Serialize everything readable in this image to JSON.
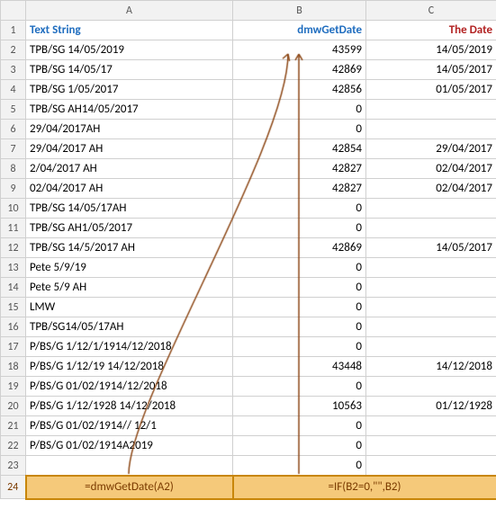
{
  "columns": {
    "row_num": "",
    "a": "A",
    "b": "B",
    "c": "C"
  },
  "header_row": {
    "label_a": "Text String",
    "label_b": "dmwGetDate",
    "label_c": "The Date"
  },
  "rows": [
    {
      "num": 2,
      "a": "TPB/SG 14/05/2019",
      "b": "43599",
      "c": "14/05/2019"
    },
    {
      "num": 3,
      "a": "TPB/SG 14/05/17",
      "b": "42869",
      "c": "14/05/2017"
    },
    {
      "num": 4,
      "a": "TPB/SG 1/05/2017",
      "b": "42856",
      "c": "01/05/2017"
    },
    {
      "num": 5,
      "a": "TPB/SG AH14/05/2017",
      "b": "0",
      "c": ""
    },
    {
      "num": 6,
      "a": "29/04/2017AH",
      "b": "0",
      "c": ""
    },
    {
      "num": 7,
      "a": "29/04/2017 AH",
      "b": "42854",
      "c": "29/04/2017"
    },
    {
      "num": 8,
      "a": "2/04/2017 AH",
      "b": "42827",
      "c": "02/04/2017"
    },
    {
      "num": 9,
      "a": " 02/04/2017 AH",
      "b": "42827",
      "c": "02/04/2017"
    },
    {
      "num": 10,
      "a": "TPB/SG 14/05/17AH",
      "b": "0",
      "c": ""
    },
    {
      "num": 11,
      "a": "TPB/SG AH1/05/2017",
      "b": "0",
      "c": ""
    },
    {
      "num": 12,
      "a": "TPB/SG 14/5/2017 AH",
      "b": "42869",
      "c": "14/05/2017"
    },
    {
      "num": 13,
      "a": "Pete 5/9/19",
      "b": "0",
      "c": ""
    },
    {
      "num": 14,
      "a": "Pete 5/9 AH",
      "b": "0",
      "c": ""
    },
    {
      "num": 15,
      "a": "LMW",
      "b": "0",
      "c": ""
    },
    {
      "num": 16,
      "a": "TPB/SG14/05/17AH",
      "b": "0",
      "c": ""
    },
    {
      "num": 17,
      "a": "P/BS/G 1/12/1/1914/12/2018",
      "b": "0",
      "c": ""
    },
    {
      "num": 18,
      "a": "P/BS/G 1/12/19 14/12/2018",
      "b": "43448",
      "c": "14/12/2018"
    },
    {
      "num": 19,
      "a": "P/BS/G 01/02/1914/12/2018",
      "b": "0",
      "c": ""
    },
    {
      "num": 20,
      "a": "P/BS/G 1/12/1928 14/12/2018",
      "b": "10563",
      "c": "01/12/1928"
    },
    {
      "num": 21,
      "a": "P/BS/G 01/02/1914// 12/1",
      "b": "0",
      "c": ""
    },
    {
      "num": 22,
      "a": "P/BS/G 01/02/1914A2019",
      "b": "0",
      "c": ""
    },
    {
      "num": 23,
      "a": "",
      "b": "0",
      "c": ""
    }
  ],
  "formula_row": {
    "num": 24,
    "formula_a": "=dmwGetDate(A2)",
    "formula_b": "=IF(B2=0,\"\",B2)"
  }
}
